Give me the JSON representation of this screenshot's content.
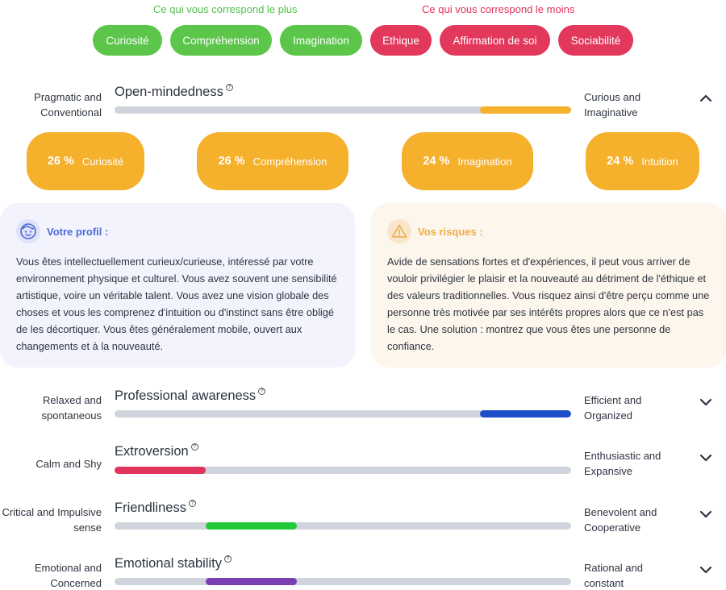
{
  "headers": {
    "plus": "Ce qui vous correspond le plus",
    "moins": "Ce qui vous correspond le moins"
  },
  "chips_plus": [
    "Curiosité",
    "Compréhension",
    "Imagination"
  ],
  "chips_moins": [
    "Ethique",
    "Affirmation de soi",
    "Sociabilité"
  ],
  "colors": {
    "green": "#5bc64a",
    "red": "#e1385c",
    "orange": "#f5b02c",
    "blue": "#1c4fc8",
    "pink": "#e1345a",
    "lime": "#22c93a",
    "purple": "#7b3fb4",
    "track": "#cfd4dc"
  },
  "openness": {
    "title": "Open-mindedness",
    "left": "Pragmatic and Conventional",
    "right": "Curious and Imaginative",
    "expanded": true,
    "bar_start": 0.8,
    "bar_end": 1.0,
    "scores": [
      {
        "pct": "26 %",
        "label": "Curiosité"
      },
      {
        "pct": "26 %",
        "label": "Compréhension"
      },
      {
        "pct": "24 %",
        "label": "Imagination"
      },
      {
        "pct": "24 %",
        "label": "Intuition"
      }
    ]
  },
  "profil": {
    "title": "Votre profil :",
    "icon": "face-icon",
    "text": "Vous êtes intellectuellement curieux/curieuse, intéressé par votre environnement physique et culturel. Vous avez souvent une sensibilité artistique, voire un véritable talent. Vous avez une vision globale des choses et vous les comprenez d'intuition ou d'instinct sans être obligé de les décortiquer. Vous êtes généralement mobile, ouvert aux changements et à la nouveauté."
  },
  "risques": {
    "title": "Vos risques :",
    "icon": "warning-icon",
    "text": "Avide de sensations fortes et d'expériences, il peut vous arriver de vouloir privilégier le plaisir et la nouveauté au détriment de l'éthique et des valeurs traditionnelles. Vous risquez ainsi d'être perçu comme une personne très motivée par ses intérêts propres alors que ce n'est pas le cas. Une solution : montrez que vous êtes une personne de confiance."
  },
  "traits": [
    {
      "title": "Professional awareness",
      "left": "Relaxed and spontaneous",
      "right": "Efficient and Organized",
      "bar_start": 0.8,
      "bar_end": 1.0,
      "color": "#1c4fc8"
    },
    {
      "title": "Extroversion",
      "left": "Calm and Shy",
      "right": "Enthusiastic and Expansive",
      "bar_start": 0.0,
      "bar_end": 0.2,
      "color": "#e1345a"
    },
    {
      "title": "Friendliness",
      "left": "Critical and Impulsive sense",
      "right": "Benevolent and Cooperative",
      "bar_start": 0.2,
      "bar_end": 0.4,
      "color": "#22c93a"
    },
    {
      "title": "Emotional stability",
      "left": "Emotional and Concerned",
      "right": "Rational and constant",
      "bar_start": 0.2,
      "bar_end": 0.4,
      "color": "#7b3fb4"
    }
  ]
}
